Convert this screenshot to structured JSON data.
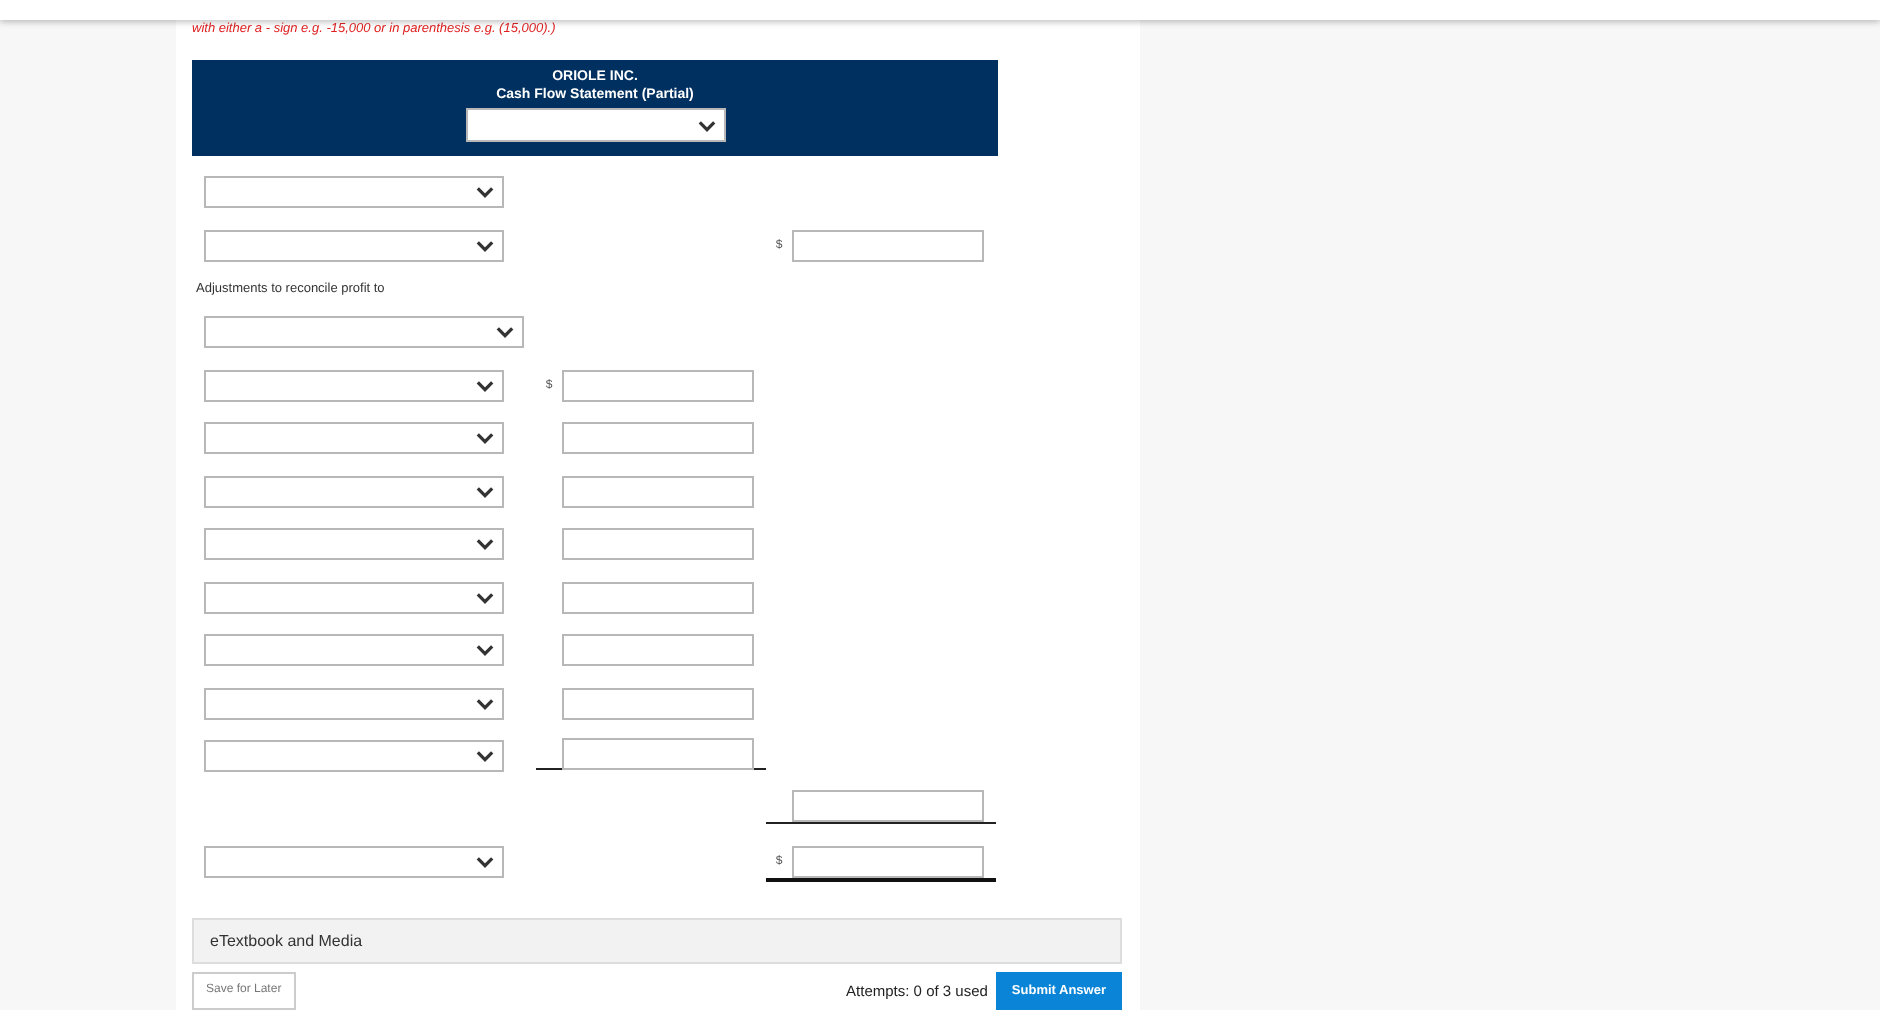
{
  "instruction": "with either a - sign e.g. -15,000 or in parenthesis e.g. (15,000).)",
  "statement": {
    "company": "ORIOLE INC.",
    "title": "Cash Flow Statement (Partial)"
  },
  "rows": [
    {
      "kind": "select"
    },
    {
      "kind": "select_total",
      "currency": "$"
    },
    {
      "kind": "label",
      "text": "Adjustments to reconcile profit to"
    },
    {
      "kind": "select_wide"
    },
    {
      "kind": "select_amount",
      "currency": "$"
    },
    {
      "kind": "select_amount"
    },
    {
      "kind": "select_amount"
    },
    {
      "kind": "select_amount"
    },
    {
      "kind": "select_amount"
    },
    {
      "kind": "select_amount"
    },
    {
      "kind": "select_amount"
    },
    {
      "kind": "select_amount_ruled"
    },
    {
      "kind": "subtotal"
    },
    {
      "kind": "grand_total",
      "currency": "$"
    }
  ],
  "resources": {
    "label": "eTextbook and Media"
  },
  "footer": {
    "save": "Save for Later",
    "attempts": "Attempts: 0 of 3 used",
    "submit": "Submit Answer"
  }
}
